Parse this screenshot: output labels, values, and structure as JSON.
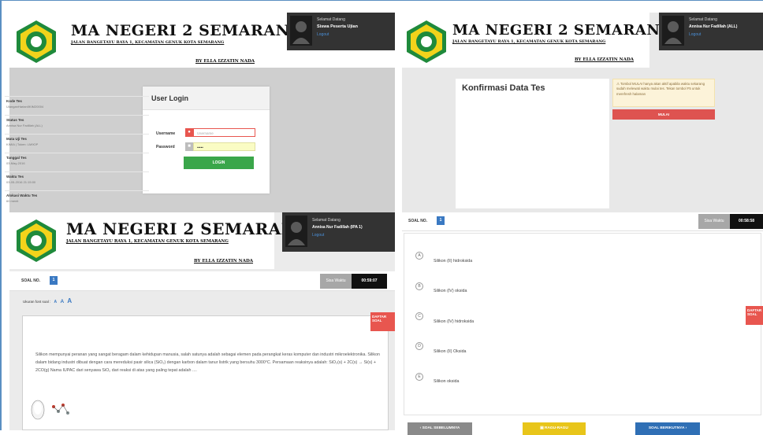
{
  "school": {
    "name": "MA NEGERI 2 SEMARANG",
    "address": "JALAN BANGETAYU RAYA 1, KECAMATAN GENUK KOTA SEMARANG",
    "byline": "BY ELLA IZZATIN NADA"
  },
  "panel_login": {
    "user": {
      "greeting": "Selamat Datang",
      "name": "Siswa Peserta Ujian",
      "logout": "Logout"
    },
    "card_title": "User Login",
    "username_label": "Username",
    "username_placeholder": "Username",
    "password_label": "Password",
    "password_value": "•••••",
    "login_button": "LOGIN"
  },
  "panel_konfirmasi": {
    "user": {
      "greeting": "Selamat Datang",
      "name": "Annisa Nur Fadillah (ALL)",
      "logout": "Logout"
    },
    "title": "Konfirmasi Data Tes",
    "rows": [
      {
        "label": "Kode Tes",
        "value": "UlanganHarianIIKIM20004"
      },
      {
        "label": "Status Tes",
        "value": "Annisa Nur Fadillah (ALL)"
      },
      {
        "label": "Mata Uji Tes",
        "value": "KIMIA | Token: LM9OP"
      },
      {
        "label": "Tanggal Tes",
        "value": "03-May-2016"
      },
      {
        "label": "Waktu Tes",
        "value": "03-05-2016 21:15:00"
      },
      {
        "label": "Alokasi Waktu Tes",
        "value": "60 menit"
      }
    ],
    "alert": "⚠ Tombol MULAI hanya akan aktif apabila waktu sekarang sudah melewati waktu mulai tes. Tekan tombol F5 untuk merefresh halaman",
    "start_button": "MULAI"
  },
  "panel_soal": {
    "user": {
      "greeting": "Selamat Datang",
      "name": "Annisa Nur Fadillah (IPA 1)",
      "logout": "Logout"
    },
    "soal_label": "SOAL NO.",
    "soal_number": "1",
    "sisa_waktu": "Sisa Waktu",
    "timer": "00:59:07",
    "font_size_label": "Ukuran font soal :",
    "font_sizes": [
      "A",
      "A",
      "A"
    ],
    "daftar_soal": "DAFTAR SOAL",
    "question": "Silikon mempunyai peranan yang sangat beragam dalam kehidupan manusia, salah satunya adalah sebagai elemen pada perangkat keras komputer dan industri mikroelektronika. Silikon dalam bidang industri dibuat dengan cara mereduksi pasir silica (SiO₂) dengan karbon dalam tanur listrik yang bersuhu 3000°C. Persamaan reaksinya adalah: SiO₂(s) + 2C(s) → Si(s) + 2CO(g) Nama IUPAC dari senyawa SiO₂ dari reaksi di atas yang paling tepat adalah ...."
  },
  "panel_options": {
    "soal_label": "SOAL NO.",
    "soal_number": "1",
    "sisa_waktu": "Sisa Waktu",
    "timer": "00:58:58",
    "daftar_soal": "DAFTAR SOAL",
    "options": [
      {
        "letter": "A",
        "text": "Silikon (II) hidroksida"
      },
      {
        "letter": "B",
        "text": "Silikon (IV) oksida"
      },
      {
        "letter": "C",
        "text": "Silikon (IV) hidroksida"
      },
      {
        "letter": "D",
        "text": "Silikon (II) Oksida"
      },
      {
        "letter": "E",
        "text": "Silikon oksida"
      }
    ],
    "prev_button": "SOAL SEBELUMNYA",
    "ragu_button": "RAGU-RAGU",
    "next_button": "SOAL BERIKUTNYA"
  },
  "colors": {
    "accent_blue": "#3a79c2",
    "green": "#3aa64a",
    "red": "#de5350",
    "yellow": "#e8c51a",
    "header_dark": "#333333",
    "page_gray": "#cfcfcf"
  }
}
